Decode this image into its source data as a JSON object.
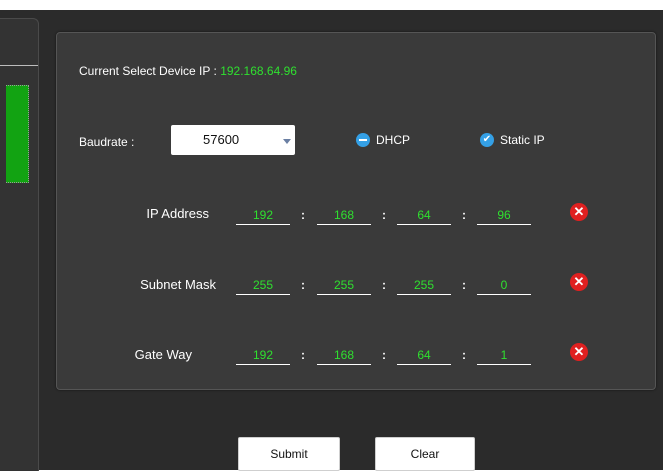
{
  "current": {
    "label": "Current Select Device IP :",
    "ip": "192.168.64.96"
  },
  "baud": {
    "label": "Baudrate :",
    "value": "57600"
  },
  "mode": {
    "dhcp_label": "DHCP",
    "static_label": "Static IP",
    "selected": "Static IP"
  },
  "rows": [
    {
      "label": "IP Address",
      "octets": [
        "192",
        "168",
        "64",
        "96"
      ]
    },
    {
      "label": "Subnet Mask",
      "octets": [
        "255",
        "255",
        "255",
        "0"
      ]
    },
    {
      "label": "Gate Way",
      "octets": [
        "192",
        "168",
        "64",
        "1"
      ]
    }
  ],
  "separator": ":",
  "clear_glyph": "✕",
  "buttons": {
    "submit": "Submit",
    "clear": "Clear"
  },
  "colors": {
    "background": "#2b2b2b",
    "panel": "#3a3a3a",
    "value_green": "#2fe02f",
    "radio_blue": "#34a0e6",
    "clear_red": "#e02020",
    "side_green": "#12a312"
  },
  "icons": {
    "dhcp": "minus-circle-icon",
    "static": "check-circle-icon",
    "clear": "close-circle-icon"
  }
}
